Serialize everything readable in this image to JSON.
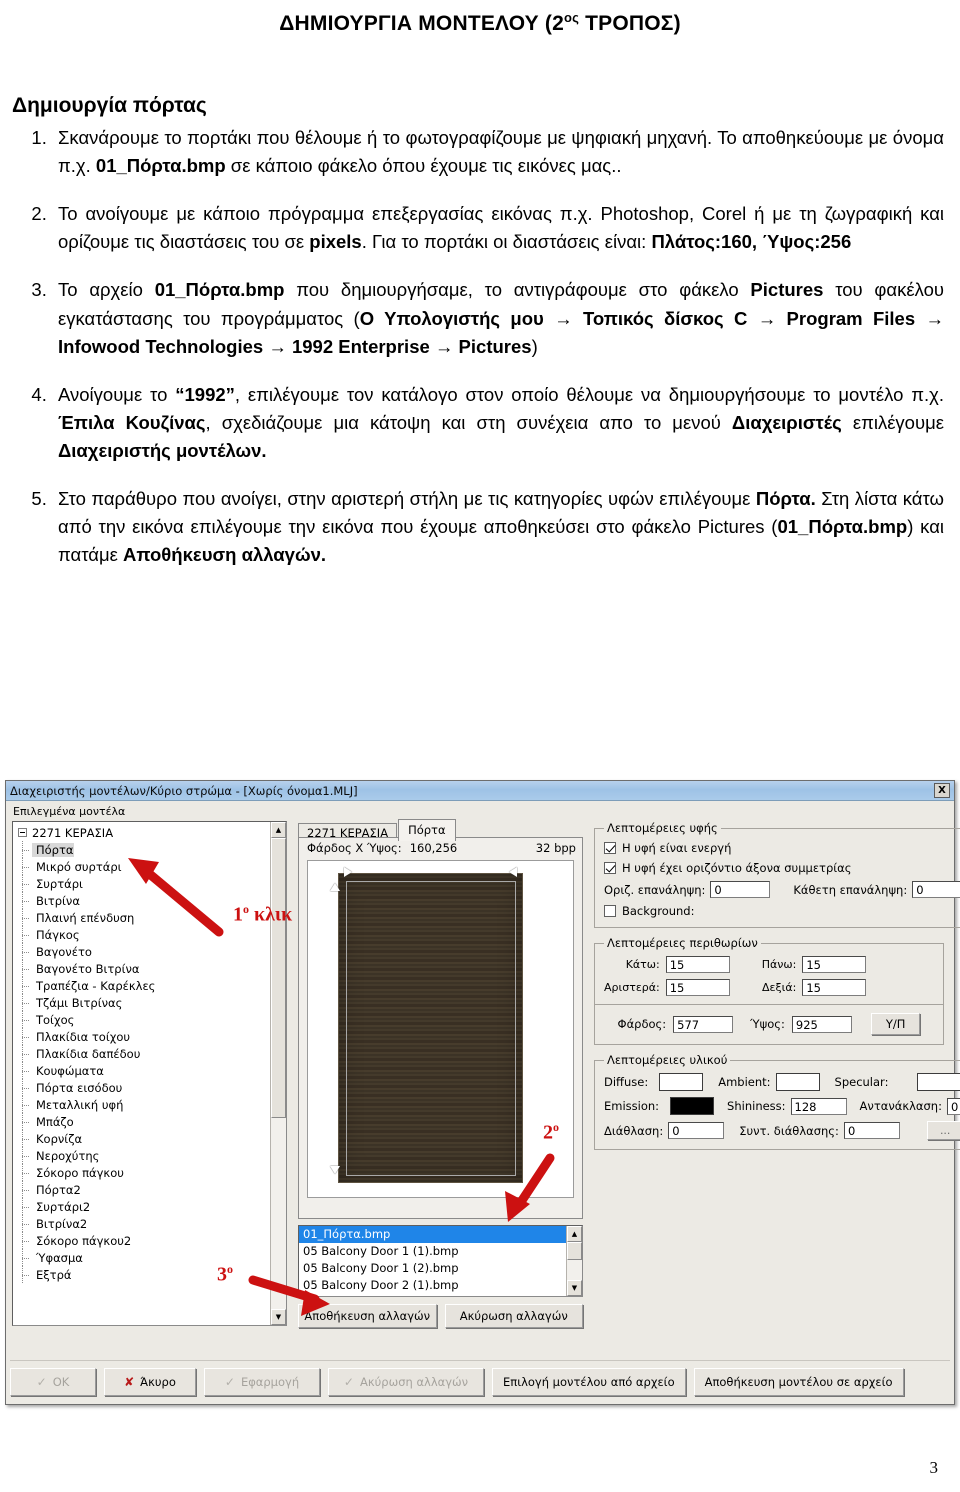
{
  "document": {
    "title_main": "ΔΗΜΙΟΥΡΓΙΑ ΜΟΝΤΕΛΟΥ (2",
    "title_sup": "ος",
    "title_tail": " ΤΡΟΠΟΣ)",
    "section_heading": "Δημιουργία πόρτας",
    "page_number": "3",
    "steps": [
      {
        "id": 1,
        "parts": [
          {
            "t": "Σκανάρουμε το πορτάκι που θέλουμε ή το φωτογραφίζουμε με ψηφιακή μηχανή. Το αποθηκεύουμε με όνομα π.χ. ",
            "b": false
          },
          {
            "t": "01_Πόρτα.bmp",
            "b": true
          },
          {
            "t": " σε κάποιο φάκελο όπου έχουμε τις εικόνες μας..",
            "b": false
          }
        ]
      },
      {
        "id": 2,
        "parts": [
          {
            "t": "Το ανοίγουμε με κάποιο πρόγραμμα επεξεργασίας εικόνας π.χ. Photoshop, Corel ή με τη ζωγραφική και ορίζουμε τις διαστάσεις του σε ",
            "b": false
          },
          {
            "t": "pixels",
            "b": true
          },
          {
            "t": ". Για το πορτάκι οι διαστάσεις είναι: ",
            "b": false
          },
          {
            "t": "Πλάτος:160, Ύψος:256",
            "b": true
          }
        ]
      },
      {
        "id": 3,
        "parts": [
          {
            "t": "Το αρχείο ",
            "b": false
          },
          {
            "t": "01_Πόρτα.bmp",
            "b": true
          },
          {
            "t": " που δημιουργήσαμε, το αντιγράφουμε στο φάκελο ",
            "b": false
          },
          {
            "t": "Pictures",
            "b": true
          },
          {
            "t": " του φακέλου εγκατάστασης του προγράμματος (",
            "b": false
          },
          {
            "t": "Ο Υπολογιστής μου → Τοπικός δίσκος C → Program Files → Infowood Technologies → 1992 Enterprise → Pictures",
            "b": true
          },
          {
            "t": ")",
            "b": false
          }
        ]
      },
      {
        "id": 4,
        "parts": [
          {
            "t": "Ανοίγουμε το ",
            "b": false
          },
          {
            "t": "“1992”",
            "b": true
          },
          {
            "t": ", επιλέγουμε τον κατάλογο στον οποίο θέλουμε να δημιουργήσουμε το μοντέλο π.χ. ",
            "b": false
          },
          {
            "t": "Έπιλα Κουζίνας",
            "b": true
          },
          {
            "t": ", σχεδιάζουμε μια κάτοψη και στη συνέχεια απο το μενού ",
            "b": false
          },
          {
            "t": "Διαχειριστές",
            "b": true
          },
          {
            "t": " επιλέγουμε ",
            "b": false
          },
          {
            "t": "Διαχειριστής μοντέλων.",
            "b": true
          }
        ]
      },
      {
        "id": 5,
        "parts": [
          {
            "t": "Στο παράθυρο που ανοίγει, στην αριστερή στήλη με τις κατηγορίες υφών επιλέγουμε ",
            "b": false
          },
          {
            "t": "Πόρτα.",
            "b": true
          },
          {
            "t": " Στη λίστα κάτω από την εικόνα επιλέγουμε την εικόνα που έχουμε αποθηκεύσει στο φάκελο Pictures (",
            "b": false
          },
          {
            "t": "01_Πόρτα.bmp",
            "b": true
          },
          {
            "t": ") και πατάμε ",
            "b": false
          },
          {
            "t": "Αποθήκευση αλλαγών.",
            "b": true
          }
        ]
      }
    ]
  },
  "dialog": {
    "title": "Διαχειριστής μοντέλων/Κύριο στρώμα - [Χωρίς όνομα1.MLJ]",
    "close_label": "X",
    "tree_group_label": "Επιλεγμένα μοντέλα",
    "tree_root": "2271 ΚΕΡΑΣΙΑ",
    "tree_items": [
      "Πόρτα",
      "Μικρό συρτάρι",
      "Συρτάρι",
      "Βιτρίνα",
      "Πλαινή επένδυση",
      "Πάγκος",
      "Βαγονέτο",
      "Βαγονέτο Βιτρίνα",
      "Τραπέζια - Καρέκλες",
      "Τζάμι Βιτρίνας",
      "Τοίχος",
      "Πλακίδια τοίχου",
      "Πλακίδια δαπέδου",
      "Κουφώματα",
      "Πόρτα εισόδου",
      "Μεταλλική υφή",
      "Μπάζο",
      "Κορνίζα",
      "Νεροχύτης",
      "Σόκορο πάγκου",
      "Πόρτα2",
      "Συρτάρι2",
      "Βιτρίνα2",
      "Σόκορο πάγκου2",
      "Ύφασμα",
      "Εξτρά"
    ],
    "tabs": [
      {
        "label": "2271 ΚΕΡΑΣΙΑ",
        "active": false
      },
      {
        "label": "Πόρτα",
        "active": true
      }
    ],
    "image_pane": {
      "dims_label": "Φάρδος Χ Ύψος:",
      "dims_value": "160,256",
      "bpp": "32 bpp"
    },
    "file_list": [
      {
        "name": "01_Πόρτα.bmp",
        "selected": true
      },
      {
        "name": "05 Balcony Door 1 (1).bmp",
        "selected": false
      },
      {
        "name": "05 Balcony Door 1 (2).bmp",
        "selected": false
      },
      {
        "name": "05 Balcony Door 2 (1).bmp",
        "selected": false
      }
    ],
    "list_buttons": [
      "Αποθήκευση αλλαγών",
      "Ακύρωση αλλαγών"
    ],
    "texture_group": {
      "legend": "Λεπτομέρειες υφής",
      "check_active": {
        "label": "Η υφή είναι ενεργή",
        "checked": true
      },
      "check_symmetry": {
        "label": "Η υφή έχει οριζόντιο άξονα συμμετρίας",
        "checked": true
      },
      "horiz_label": "Οριζ. επανάληψη:",
      "horiz_value": "0",
      "vert_label": "Κάθετη επανάληψη:",
      "vert_value": "0",
      "background": {
        "label": "Background:",
        "checked": false
      }
    },
    "margins_group": {
      "legend": "Λεπτομέρειες περιθωρίων",
      "bottom_label": "Κάτω:",
      "bottom_value": "15",
      "top_label": "Πάνω:",
      "top_value": "15",
      "left_label": "Αριστερά:",
      "left_value": "15",
      "right_label": "Δεξιά:",
      "right_value": "15",
      "width_label": "Φάρδος:",
      "width_value": "577",
      "height_label": "Ύψος:",
      "height_value": "925",
      "ylp_button": "Υ/Π"
    },
    "material_group": {
      "legend": "Λεπτομέρειες υλικού",
      "diffuse_label": "Diffuse:",
      "diffuse_color": "#ffffff",
      "ambient_label": "Ambient:",
      "ambient_color": "#ffffff",
      "specular_label": "Specular:",
      "specular_color": "#ffffff",
      "emission_label": "Emission:",
      "emission_color": "#000000",
      "shininess_label": "Shininess:",
      "shininess_value": "128",
      "reflection_label": "Αντανάκλαση:",
      "reflection_value": "0",
      "refraction_label": "Διάθλαση:",
      "refraction_value": "0",
      "refraction_coef_label": "Συντ. διάθλασης:",
      "refraction_coef_value": "0",
      "more_button": "..."
    },
    "bottom_buttons": [
      {
        "label": "OK",
        "icon": "check-icon",
        "disabled": true
      },
      {
        "label": "Άκυρο",
        "icon": "x-icon",
        "disabled": false
      },
      {
        "label": "Εφαρμογή",
        "icon": "check-icon",
        "disabled": true
      },
      {
        "label": "Ακύρωση αλλαγών",
        "icon": "check-icon",
        "disabled": true
      },
      {
        "label": "Επιλογή μοντέλου από αρχείο",
        "icon": "",
        "disabled": false
      },
      {
        "label": "Αποθήκευση μοντέλου σε αρχείο",
        "icon": "",
        "disabled": false
      }
    ]
  },
  "annotations": [
    {
      "text": "1",
      "ord": "ο",
      "suffix": " κλικ"
    },
    {
      "text": "2",
      "ord": "ο",
      "suffix": ""
    },
    {
      "text": "3",
      "ord": "ο",
      "suffix": ""
    }
  ],
  "colors": {
    "titlebar": "#9ec2e6",
    "annotation_red": "#cc1111",
    "selection_blue": "#1f85e8",
    "door_wood": "#3c3326"
  }
}
